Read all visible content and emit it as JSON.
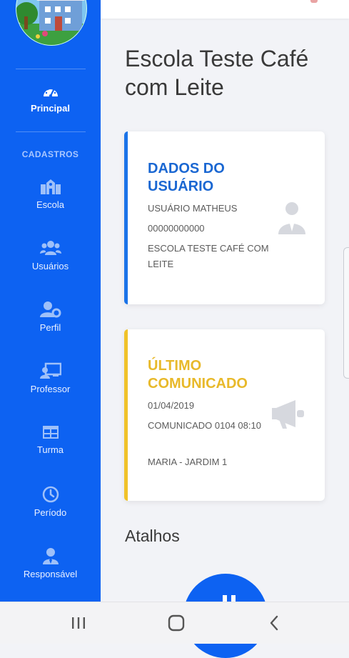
{
  "sidebar": {
    "section_title": "CADASTROS",
    "items": [
      {
        "label": "Principal",
        "icon": "dashboard-gauge-icon",
        "active": true
      },
      {
        "label": "Escola",
        "icon": "school-building-icon"
      },
      {
        "label": "Usuários",
        "icon": "users-group-icon"
      },
      {
        "label": "Perfil",
        "icon": "user-gear-icon"
      },
      {
        "label": "Professor",
        "icon": "chalkboard-teacher-icon"
      },
      {
        "label": "Turma",
        "icon": "table-grid-icon"
      },
      {
        "label": "Período",
        "icon": "clock-icon"
      },
      {
        "label": "Responsável",
        "icon": "user-tie-icon"
      }
    ]
  },
  "main": {
    "title": "Escola Teste Café com Leite",
    "shortcuts_title": "Atalhos"
  },
  "cards": {
    "user": {
      "title": "DADOS DO USUÁRIO",
      "name": "USUÁRIO MATHEUS",
      "document": "00000000000",
      "school": "ESCOLA TESTE CAFÉ COM LEITE",
      "accent": "#1a73e8",
      "title_color": "#1a67d2",
      "icon": "user-tie-icon"
    },
    "notice": {
      "title": "ÚLTIMO COMUNICADO",
      "date": "01/04/2019",
      "subject": "COMUNICADO 0104 08:10",
      "author": "MARIA - JARDIM 1",
      "accent": "#f0c229",
      "title_color": "#e8b92a",
      "icon": "megaphone-icon"
    }
  },
  "colors": {
    "sidebar_bg": "#0d62f2",
    "page_bg": "#f2f3f7"
  },
  "android_nav": [
    "recent-apps-icon",
    "home-icon",
    "back-icon"
  ]
}
